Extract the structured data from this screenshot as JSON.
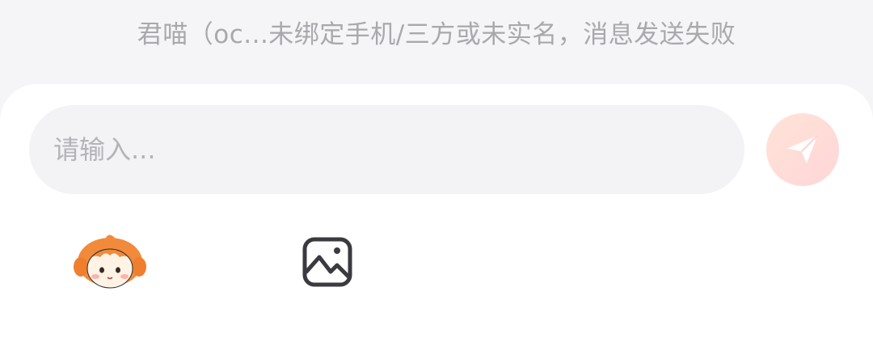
{
  "notice": {
    "text": "君喵（oc...未绑定手机/三方或未实名，消息发送失败"
  },
  "composer": {
    "placeholder": "请输入..."
  },
  "icons": {
    "send": "send-icon",
    "avatar": "avatar-sticker-icon",
    "image": "image-icon"
  },
  "colors": {
    "send_bg": "#ffdcd7",
    "send_glyph": "#ffffff",
    "avatar_hair": "#f28a3c",
    "image_icon": "#3a3a3f"
  }
}
